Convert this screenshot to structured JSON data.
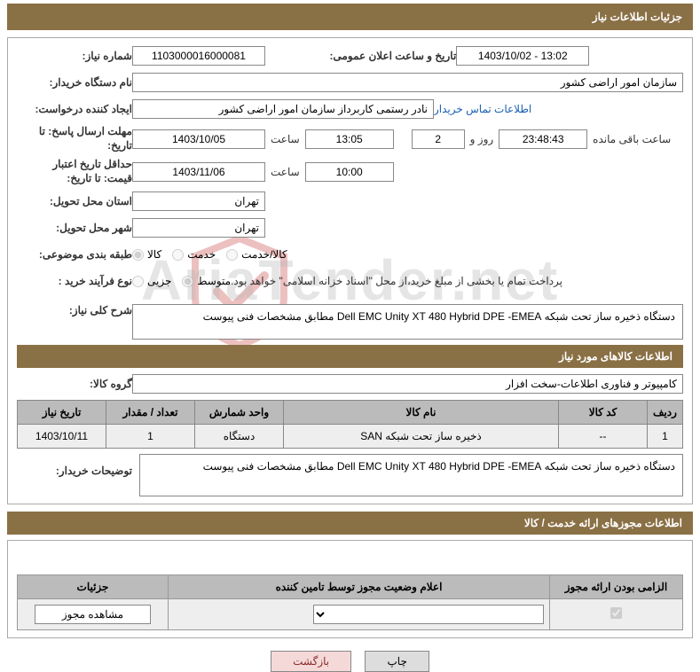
{
  "header": {
    "title": "جزئیات اطلاعات نیاز"
  },
  "fields": {
    "need_number_label": "شماره نیاز:",
    "need_number": "1103000016000081",
    "announce_datetime_label": "تاریخ و ساعت اعلان عمومی:",
    "announce_datetime": "1403/10/02 - 13:02",
    "buyer_org_label": "نام دستگاه خریدار:",
    "buyer_org": "سازمان امور اراضی کشور",
    "requester_label": "ایجاد کننده درخواست:",
    "requester": "نادر رستمی کاربرداز سازمان امور اراضی کشور",
    "contact_link": "اطلاعات تماس خریدار",
    "response_deadline_label": "مهلت ارسال پاسخ: تا تاریخ:",
    "response_date": "1403/10/05",
    "time_label": "ساعت",
    "response_time": "13:05",
    "remaining_days": "2",
    "days_and": "روز و",
    "remaining_time": "23:48:43",
    "remaining_label": "ساعت باقی مانده",
    "price_validity_label": "حداقل تاریخ اعتبار قیمت: تا تاریخ:",
    "price_validity_date": "1403/11/06",
    "price_validity_time": "10:00",
    "delivery_province_label": "استان محل تحویل:",
    "delivery_province": "تهران",
    "delivery_city_label": "شهر محل تحویل:",
    "delivery_city": "تهران",
    "category_label": "طبقه بندی موضوعی:",
    "cat_goods": "کالا",
    "cat_service": "خدمت",
    "cat_goods_service": "کالا/خدمت",
    "process_type_label": "نوع فرآیند خرید :",
    "proc_partial": "جزیی",
    "proc_medium": "متوسط",
    "process_note": "پرداخت تمام یا بخشی از مبلغ خرید،از محل \"اسناد خزانه اسلامی\" خواهد بود.",
    "general_desc_label": "شرح کلی نیاز:",
    "general_desc": "دستگاه ذخیره ساز تحت شبکه Dell EMC Unity XT 480 Hybrid DPE -EMEA مطابق مشخصات فنی پیوست"
  },
  "goods_section": {
    "title": "اطلاعات کالاهای مورد نیاز",
    "group_label": "گروه کالا:",
    "group_value": "کامپیوتر و فناوری اطلاعات-سخت افزار",
    "headers": {
      "row": "ردیف",
      "code": "کد کالا",
      "name": "نام کالا",
      "unit": "واحد شمارش",
      "qty": "تعداد / مقدار",
      "need_date": "تاریخ نیاز"
    },
    "rows": [
      {
        "row": "1",
        "code": "--",
        "name": "ذخیره ساز تحت شبکه SAN",
        "unit": "دستگاه",
        "qty": "1",
        "need_date": "1403/10/11"
      }
    ],
    "buyer_notes_label": "توضیحات خریدار:",
    "buyer_notes": "دستگاه ذخیره ساز تحت شبکه Dell EMC Unity XT 480 Hybrid DPE -EMEA مطابق مشخصات فنی پیوست"
  },
  "license_section": {
    "title": "اطلاعات مجوزهای ارائه خدمت / کالا",
    "headers": {
      "mandatory": "الزامی بودن ارائه مجوز",
      "status": "اعلام وضعیت مجوز توسط تامین کننده",
      "details": "جزئیات"
    },
    "view_btn": "مشاهده مجوز"
  },
  "actions": {
    "print": "چاپ",
    "back": "بازگشت"
  }
}
